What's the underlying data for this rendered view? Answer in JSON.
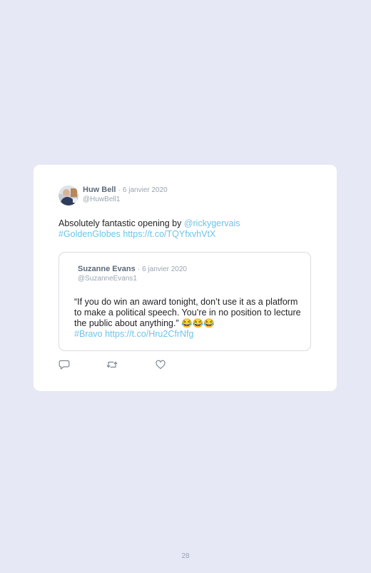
{
  "tweet": {
    "author_name": "Huw Bell",
    "separator": "·",
    "date": "6 janvier 2020",
    "handle": "@HuwBell1",
    "text_before": "Absolutely fantastic opening by ",
    "mention": "@rickygervais",
    "hashtag": "#GoldenGlobes",
    "link": "https://t.co/TQYfxvhVtX"
  },
  "quoted_tweet": {
    "author_name": "Suzanne Evans",
    "separator": "·",
    "date": "6 janvier 2020",
    "handle": "@SuzanneEvans1",
    "text": "“If you do win an award tonight, don’t use it as a platform to make a political speech. You’re in no position to lecture the public about anything.” 😂😂😂",
    "hashtag": "#Bravo",
    "link": "https://t.co/Hru2CfrNfg"
  },
  "actions": {
    "reply_icon": "reply-icon",
    "retweet_icon": "retweet-icon",
    "like_icon": "heart-icon"
  },
  "colors": {
    "background": "#e6e8f5",
    "card": "#ffffff",
    "link": "#6fc3e9",
    "muted": "#9aa5b1"
  },
  "page": {
    "number": "28"
  }
}
